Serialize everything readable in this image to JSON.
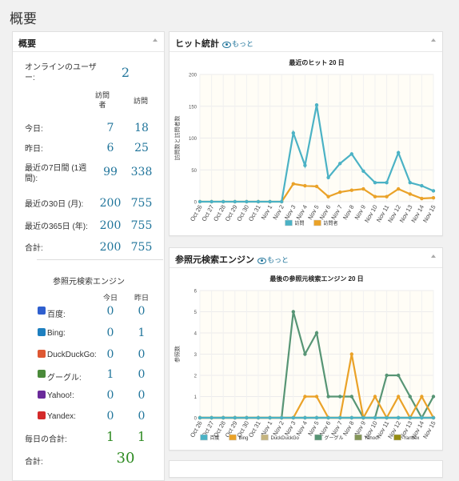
{
  "page_title": "概要",
  "summary": {
    "title": "概要",
    "online_label": "オンラインのユーザー:",
    "online_value": "2",
    "col_visitors": "訪問者",
    "col_visits": "訪問",
    "rows": [
      {
        "label": "今日:",
        "visitors": "7",
        "visits": "18"
      },
      {
        "label": "昨日:",
        "visitors": "6",
        "visits": "25"
      },
      {
        "label": "最近の7日間 (1週間):",
        "visitors": "99",
        "visits": "338"
      },
      {
        "label": "最近の30日 (月):",
        "visitors": "200",
        "visits": "755"
      },
      {
        "label": "最近の365日 (年):",
        "visitors": "200",
        "visits": "755"
      },
      {
        "label": "合計:",
        "visitors": "200",
        "visits": "755"
      }
    ],
    "search_title": "参照元検索エンジン",
    "col_today": "今日",
    "col_yesterday": "昨日",
    "engines": [
      {
        "label": "百度:",
        "today": "0",
        "yesterday": "0",
        "icon": "baidu-icon",
        "color": "#2f5fcf"
      },
      {
        "label": "Bing:",
        "today": "0",
        "yesterday": "1",
        "icon": "bing-icon",
        "color": "#1e7fbf"
      },
      {
        "label": "DuckDuckGo:",
        "today": "0",
        "yesterday": "0",
        "icon": "duckduckgo-icon",
        "color": "#de5833"
      },
      {
        "label": "グーグル:",
        "today": "1",
        "yesterday": "0",
        "icon": "google-icon",
        "color": "#4a8a3a"
      },
      {
        "label": "Yahoo!:",
        "today": "0",
        "yesterday": "0",
        "icon": "yahoo-icon",
        "color": "#6a2a9a"
      },
      {
        "label": "Yandex:",
        "today": "0",
        "yesterday": "0",
        "icon": "yandex-icon",
        "color": "#d42a2a"
      }
    ],
    "daily_total_label": "毎日の合計:",
    "daily_total_today": "1",
    "daily_total_yesterday": "1",
    "total_label": "合計:",
    "total_value": "30"
  },
  "hits_box": {
    "title": "ヒット統計",
    "more": "もっと"
  },
  "search_box": {
    "title": "参照元検索エンジン",
    "more": "もっと"
  },
  "chart_data": [
    {
      "type": "line",
      "title": "最近のヒット 20 日",
      "ylabel": "訪問数と訪問者数",
      "ylim": [
        0,
        200
      ],
      "yticks": [
        0,
        50,
        100,
        150,
        200
      ],
      "grid": true,
      "legend": "bottom",
      "categories": [
        "Oct 26",
        "Oct 27",
        "Oct 28",
        "Oct 29",
        "Oct 30",
        "Oct 31",
        "Nov 1",
        "Nov 2",
        "Nov 3",
        "Nov 4",
        "Nov 5",
        "Nov 6",
        "Nov 7",
        "Nov 8",
        "Nov 9",
        "Nov 10",
        "Nov 11",
        "Nov 12",
        "Nov 13",
        "Nov 14",
        "Nov 15"
      ],
      "series": [
        {
          "name": "訪問",
          "color": "#4bb2c5",
          "values": [
            0,
            0,
            0,
            0,
            0,
            0,
            0,
            0,
            108,
            57,
            152,
            38,
            60,
            75,
            48,
            30,
            30,
            77,
            30,
            25,
            17
          ]
        },
        {
          "name": "訪問者",
          "color": "#eaa228",
          "values": [
            0,
            0,
            0,
            0,
            0,
            0,
            0,
            0,
            28,
            25,
            24,
            8,
            15,
            18,
            20,
            8,
            8,
            20,
            12,
            5,
            6
          ]
        }
      ]
    },
    {
      "type": "line",
      "title": "最後の参照元検索エンジン 20 日",
      "ylabel": "参照数",
      "ylim": [
        0,
        6
      ],
      "yticks": [
        0,
        1,
        2,
        3,
        4,
        5,
        6
      ],
      "grid": true,
      "legend": "bottom",
      "categories": [
        "Oct 26",
        "Oct 27",
        "Oct 28",
        "Oct 29",
        "Oct 30",
        "Oct 31",
        "Nov 1",
        "Nov 2",
        "Nov 3",
        "Nov 4",
        "Nov 5",
        "Nov 6",
        "Nov 7",
        "Nov 8",
        "Nov 9",
        "Nov 10",
        "Nov 11",
        "Nov 12",
        "Nov 13",
        "Nov 14",
        "Nov 15"
      ],
      "series": [
        {
          "name": "百度",
          "color": "#4bb2c5",
          "values": [
            0,
            0,
            0,
            0,
            0,
            0,
            0,
            0,
            0,
            0,
            0,
            0,
            0,
            0,
            0,
            0,
            0,
            0,
            0,
            0,
            0
          ]
        },
        {
          "name": "Bing",
          "color": "#eaa228",
          "values": [
            0,
            0,
            0,
            0,
            0,
            0,
            0,
            0,
            0,
            1,
            1,
            0,
            0,
            3,
            0,
            1,
            0,
            1,
            0,
            1,
            0
          ]
        },
        {
          "name": "DuckDuckGo",
          "color": "#c5b47f",
          "values": [
            0,
            0,
            0,
            0,
            0,
            0,
            0,
            0,
            0,
            0,
            0,
            0,
            0,
            0,
            0,
            0,
            0,
            0,
            0,
            0,
            0
          ]
        },
        {
          "name": "グーグル",
          "color": "#579575",
          "values": [
            0,
            0,
            0,
            0,
            0,
            0,
            0,
            0,
            5,
            3,
            4,
            1,
            1,
            1,
            0,
            0,
            2,
            2,
            1,
            0,
            1
          ]
        },
        {
          "name": "Yahoo!",
          "color": "#839557",
          "values": [
            0,
            0,
            0,
            0,
            0,
            0,
            0,
            0,
            0,
            0,
            0,
            0,
            0,
            0,
            0,
            0,
            0,
            0,
            0,
            0,
            0
          ]
        },
        {
          "name": "Yandex",
          "color": "#958c12",
          "values": [
            0,
            0,
            0,
            0,
            0,
            0,
            0,
            0,
            0,
            0,
            0,
            0,
            0,
            0,
            0,
            0,
            0,
            0,
            0,
            0,
            0
          ]
        }
      ]
    }
  ]
}
